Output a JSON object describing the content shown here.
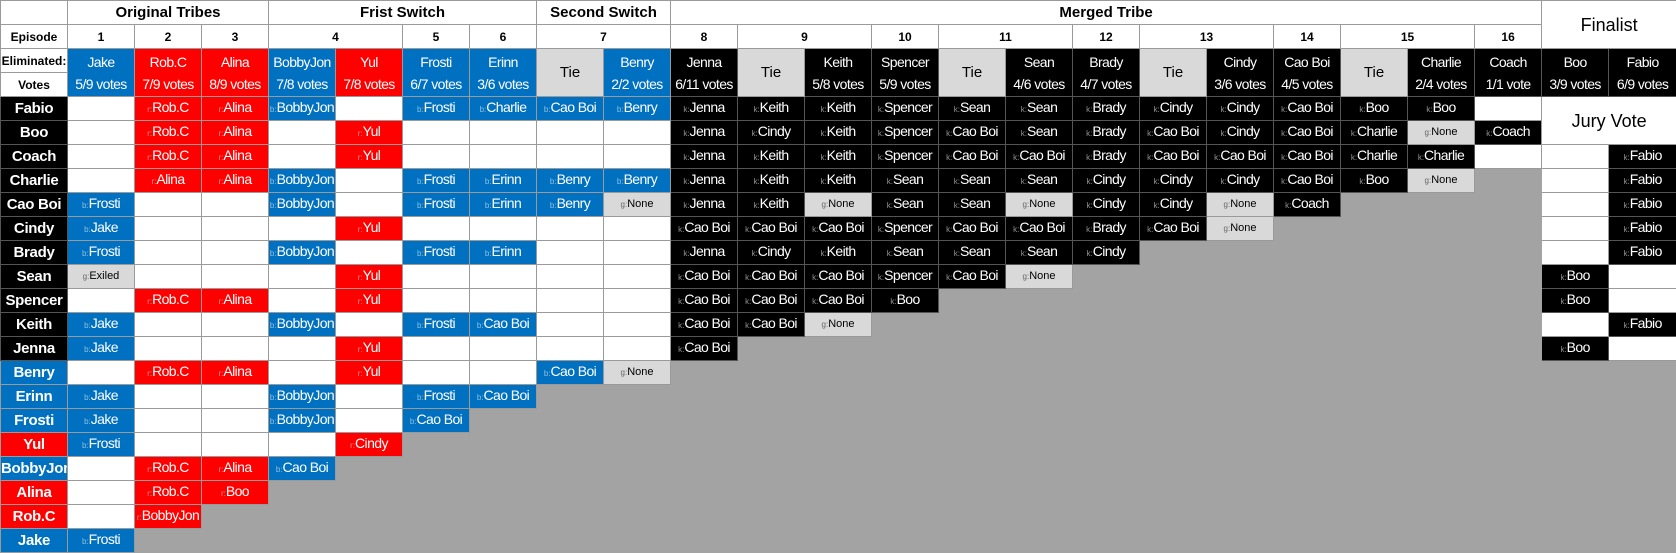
{
  "colors": {
    "blue": "#0070c0",
    "red": "#ff0000",
    "black": "#000000",
    "tie_gray": "#d9d9d9",
    "empty_gray": "#a3a3a3"
  },
  "phases": [
    {
      "label": "Original Tribes",
      "span": 3
    },
    {
      "label": "Frist Switch",
      "span": 4
    },
    {
      "label": "Second Switch",
      "span": 2
    },
    {
      "label": "Merged Tribe",
      "span": 13
    }
  ],
  "finalist_label": "Finalist",
  "episode_label": "Episode",
  "episodes": [
    {
      "n": "1",
      "span": 1
    },
    {
      "n": "2",
      "span": 1
    },
    {
      "n": "3",
      "span": 1
    },
    {
      "n": "4",
      "span": 2
    },
    {
      "n": "5",
      "span": 1
    },
    {
      "n": "6",
      "span": 1
    },
    {
      "n": "7",
      "span": 2
    },
    {
      "n": "8",
      "span": 1
    },
    {
      "n": "9",
      "span": 2
    },
    {
      "n": "10",
      "span": 1
    },
    {
      "n": "11",
      "span": 2
    },
    {
      "n": "12",
      "span": 1
    },
    {
      "n": "13",
      "span": 2
    },
    {
      "n": "14",
      "span": 1
    },
    {
      "n": "15",
      "span": 2
    },
    {
      "n": "16",
      "span": 1
    }
  ],
  "eliminated_label": "Eliminated:",
  "votes_label": "Votes",
  "eliminated": [
    [
      "b",
      "Jake",
      "5/9 votes"
    ],
    [
      "r",
      "Rob.C",
      "7/9 votes"
    ],
    [
      "r",
      "Alina",
      "8/9 votes"
    ],
    [
      "b",
      "BobbyJon",
      "7/8 votes"
    ],
    [
      "r",
      "Yul",
      "7/8 votes"
    ],
    [
      "b",
      "Frosti",
      "6/7 votes"
    ],
    [
      "b",
      "Erinn",
      "3/6 votes"
    ],
    [
      "g",
      "Tie",
      ""
    ],
    [
      "b",
      "Benry",
      "2/2 votes"
    ],
    [
      "k",
      "Jenna",
      "6/11 votes"
    ],
    [
      "g",
      "Tie",
      ""
    ],
    [
      "k",
      "Keith",
      "5/8 votes"
    ],
    [
      "k",
      "Spencer",
      "5/9 votes"
    ],
    [
      "g",
      "Tie",
      ""
    ],
    [
      "k",
      "Sean",
      "4/6 votes"
    ],
    [
      "k",
      "Brady",
      "4/7 votes"
    ],
    [
      "g",
      "Tie",
      ""
    ],
    [
      "k",
      "Cindy",
      "3/6 votes"
    ],
    [
      "k",
      "Cao Boi",
      "4/5 votes"
    ],
    [
      "g",
      "Tie",
      ""
    ],
    [
      "k",
      "Charlie",
      "2/4 votes"
    ],
    [
      "k",
      "Coach",
      "1/1 vote"
    ],
    [
      "k",
      "Boo",
      "3/9 votes"
    ],
    [
      "k",
      "Fabio",
      "6/9 votes"
    ]
  ],
  "jury_vote_label": "Jury Vote",
  "players": [
    {
      "name": "Fabio",
      "color": "k",
      "cells": [
        "w:",
        "r:Rob.C",
        "r:Alina",
        "b:BobbyJon",
        "w:",
        "b:Frosti",
        "b:Charlie",
        "b:Cao Boi",
        "b:Benry",
        "k:Jenna",
        "k:Keith",
        "k:Keith",
        "k:Spencer",
        "k:Sean",
        "k:Sean",
        "k:Brady",
        "k:Cindy",
        "k:Cindy",
        "k:Cao Boi",
        "k:Boo",
        "k:Boo",
        "w:",
        "J:",
        "J:"
      ]
    },
    {
      "name": "Boo",
      "color": "k",
      "cells": [
        "w:",
        "r:Rob.C",
        "r:Alina",
        "w:",
        "r:Yul",
        "w:",
        "w:",
        "w:",
        "w:",
        "k:Jenna",
        "k:Cindy",
        "k:Keith",
        "k:Spencer",
        "k:Cao Boi",
        "k:Sean",
        "k:Brady",
        "k:Cao Boi",
        "k:Cindy",
        "k:Cao Boi",
        "k:Charlie",
        "g:None",
        "k:Coach",
        "J:",
        "J:"
      ]
    },
    {
      "name": "Coach",
      "color": "k",
      "cells": [
        "w:",
        "r:Rob.C",
        "r:Alina",
        "w:",
        "r:Yul",
        "w:",
        "w:",
        "w:",
        "w:",
        "k:Jenna",
        "k:Keith",
        "k:Keith",
        "k:Spencer",
        "k:Cao Boi",
        "k:Cao Boi",
        "k:Brady",
        "k:Cao Boi",
        "k:Cao Boi",
        "k:Cao Boi",
        "k:Charlie",
        "k:Charlie",
        "w:",
        "w:",
        "k:Fabio"
      ]
    },
    {
      "name": "Charlie",
      "color": "k",
      "cells": [
        "w:",
        "r:Alina",
        "r:Alina",
        "b:BobbyJon",
        "w:",
        "b:Frosti",
        "b:Erinn",
        "b:Benry",
        "b:Benry",
        "k:Jenna",
        "k:Keith",
        "k:Keith",
        "k:Sean",
        "k:Sean",
        "k:Sean",
        "k:Cindy",
        "k:Cindy",
        "k:Cindy",
        "k:Cao Boi",
        "k:Boo",
        "g:None",
        "x:",
        "w:",
        "k:Fabio"
      ]
    },
    {
      "name": "Cao Boi",
      "color": "k",
      "cells": [
        "b:Frosti",
        "w:",
        "w:",
        "b:BobbyJon",
        "w:",
        "b:Frosti",
        "b:Erinn",
        "b:Benry",
        "g:None",
        "k:Jenna",
        "k:Keith",
        "g:None",
        "k:Sean",
        "k:Sean",
        "g:None",
        "k:Cindy",
        "k:Cindy",
        "g:None",
        "k:Coach",
        "x:",
        "x:",
        "x:",
        "w:",
        "k:Fabio"
      ]
    },
    {
      "name": "Cindy",
      "color": "k",
      "cells": [
        "b:Jake",
        "w:",
        "w:",
        "w:",
        "r:Yul",
        "w:",
        "w:",
        "w:",
        "w:",
        "k:Cao Boi",
        "k:Cao Boi",
        "k:Cao Boi",
        "k:Spencer",
        "k:Cao Boi",
        "k:Cao Boi",
        "k:Brady",
        "k:Cao Boi",
        "g:None",
        "x:",
        "x:",
        "x:",
        "x:",
        "w:",
        "k:Fabio"
      ]
    },
    {
      "name": "Brady",
      "color": "k",
      "cells": [
        "b:Frosti",
        "w:",
        "w:",
        "b:BobbyJon",
        "w:",
        "b:Frosti",
        "b:Erinn",
        "w:",
        "w:",
        "k:Jenna",
        "k:Cindy",
        "k:Keith",
        "k:Sean",
        "k:Sean",
        "k:Sean",
        "k:Cindy",
        "x:",
        "x:",
        "x:",
        "x:",
        "x:",
        "x:",
        "w:",
        "k:Fabio"
      ]
    },
    {
      "name": "Sean",
      "color": "k",
      "cells": [
        "g:Exiled",
        "w:",
        "w:",
        "w:",
        "r:Yul",
        "w:",
        "w:",
        "w:",
        "w:",
        "k:Cao Boi",
        "k:Cao Boi",
        "k:Cao Boi",
        "k:Spencer",
        "k:Cao Boi",
        "g:None",
        "x:",
        "x:",
        "x:",
        "x:",
        "x:",
        "x:",
        "x:",
        "k:Boo",
        "w:"
      ]
    },
    {
      "name": "Spencer",
      "color": "k",
      "cells": [
        "w:",
        "r:Rob.C",
        "r:Alina",
        "w:",
        "r:Yul",
        "w:",
        "w:",
        "w:",
        "w:",
        "k:Cao Boi",
        "k:Cao Boi",
        "k:Cao Boi",
        "k:Boo",
        "x:",
        "x:",
        "x:",
        "x:",
        "x:",
        "x:",
        "x:",
        "x:",
        "x:",
        "k:Boo",
        "w:"
      ]
    },
    {
      "name": "Keith",
      "color": "k",
      "cells": [
        "b:Jake",
        "w:",
        "w:",
        "b:BobbyJon",
        "w:",
        "b:Frosti",
        "b:Cao Boi",
        "w:",
        "w:",
        "k:Cao Boi",
        "k:Cao Boi",
        "g:None",
        "x:",
        "x:",
        "x:",
        "x:",
        "x:",
        "x:",
        "x:",
        "x:",
        "x:",
        "x:",
        "w:",
        "k:Fabio"
      ]
    },
    {
      "name": "Jenna",
      "color": "k",
      "cells": [
        "b:Jake",
        "w:",
        "w:",
        "w:",
        "r:Yul",
        "w:",
        "w:",
        "w:",
        "w:",
        "k:Cao Boi",
        "x:",
        "x:",
        "x:",
        "x:",
        "x:",
        "x:",
        "x:",
        "x:",
        "x:",
        "x:",
        "x:",
        "x:",
        "k:Boo",
        "w:"
      ]
    },
    {
      "name": "Benry",
      "color": "b",
      "cells": [
        "w:",
        "r:Rob.C",
        "r:Alina",
        "w:",
        "r:Yul",
        "w:",
        "w:",
        "b:Cao Boi",
        "g:None",
        "x:",
        "x:",
        "x:",
        "x:",
        "x:",
        "x:",
        "x:",
        "x:",
        "x:",
        "x:",
        "x:",
        "x:",
        "x:",
        "x:",
        "x:"
      ]
    },
    {
      "name": "Erinn",
      "color": "b",
      "cells": [
        "b:Jake",
        "w:",
        "w:",
        "b:BobbyJon",
        "w:",
        "b:Frosti",
        "b:Cao Boi",
        "x:",
        "x:",
        "x:",
        "x:",
        "x:",
        "x:",
        "x:",
        "x:",
        "x:",
        "x:",
        "x:",
        "x:",
        "x:",
        "x:",
        "x:",
        "x:",
        "x:"
      ]
    },
    {
      "name": "Frosti",
      "color": "b",
      "cells": [
        "b:Jake",
        "w:",
        "w:",
        "b:BobbyJon",
        "w:",
        "b:Cao Boi",
        "x:",
        "x:",
        "x:",
        "x:",
        "x:",
        "x:",
        "x:",
        "x:",
        "x:",
        "x:",
        "x:",
        "x:",
        "x:",
        "x:",
        "x:",
        "x:",
        "x:",
        "x:"
      ]
    },
    {
      "name": "Yul",
      "color": "r",
      "cells": [
        "b:Frosti",
        "w:",
        "w:",
        "w:",
        "r:Cindy",
        "x:",
        "x:",
        "x:",
        "x:",
        "x:",
        "x:",
        "x:",
        "x:",
        "x:",
        "x:",
        "x:",
        "x:",
        "x:",
        "x:",
        "x:",
        "x:",
        "x:",
        "x:",
        "x:"
      ]
    },
    {
      "name": "BobbyJon",
      "color": "b",
      "cells": [
        "w:",
        "r:Rob.C",
        "r:Alina",
        "b:Cao Boi",
        "x:",
        "x:",
        "x:",
        "x:",
        "x:",
        "x:",
        "x:",
        "x:",
        "x:",
        "x:",
        "x:",
        "x:",
        "x:",
        "x:",
        "x:",
        "x:",
        "x:",
        "x:",
        "x:",
        "x:"
      ]
    },
    {
      "name": "Alina",
      "color": "r",
      "cells": [
        "w:",
        "r:Rob.C",
        "r:Boo",
        "x:",
        "x:",
        "x:",
        "x:",
        "x:",
        "x:",
        "x:",
        "x:",
        "x:",
        "x:",
        "x:",
        "x:",
        "x:",
        "x:",
        "x:",
        "x:",
        "x:",
        "x:",
        "x:",
        "x:",
        "x:"
      ]
    },
    {
      "name": "Rob.C",
      "color": "r",
      "cells": [
        "w:",
        "r:BobbyJon",
        "x:",
        "x:",
        "x:",
        "x:",
        "x:",
        "x:",
        "x:",
        "x:",
        "x:",
        "x:",
        "x:",
        "x:",
        "x:",
        "x:",
        "x:",
        "x:",
        "x:",
        "x:",
        "x:",
        "x:",
        "x:",
        "x:"
      ]
    },
    {
      "name": "Jake",
      "color": "b",
      "cells": [
        "b:Frosti",
        "x:",
        "x:",
        "x:",
        "x:",
        "x:",
        "x:",
        "x:",
        "x:",
        "x:",
        "x:",
        "x:",
        "x:",
        "x:",
        "x:",
        "x:",
        "x:",
        "x:",
        "x:",
        "x:",
        "x:",
        "x:",
        "x:",
        "x:"
      ]
    }
  ]
}
